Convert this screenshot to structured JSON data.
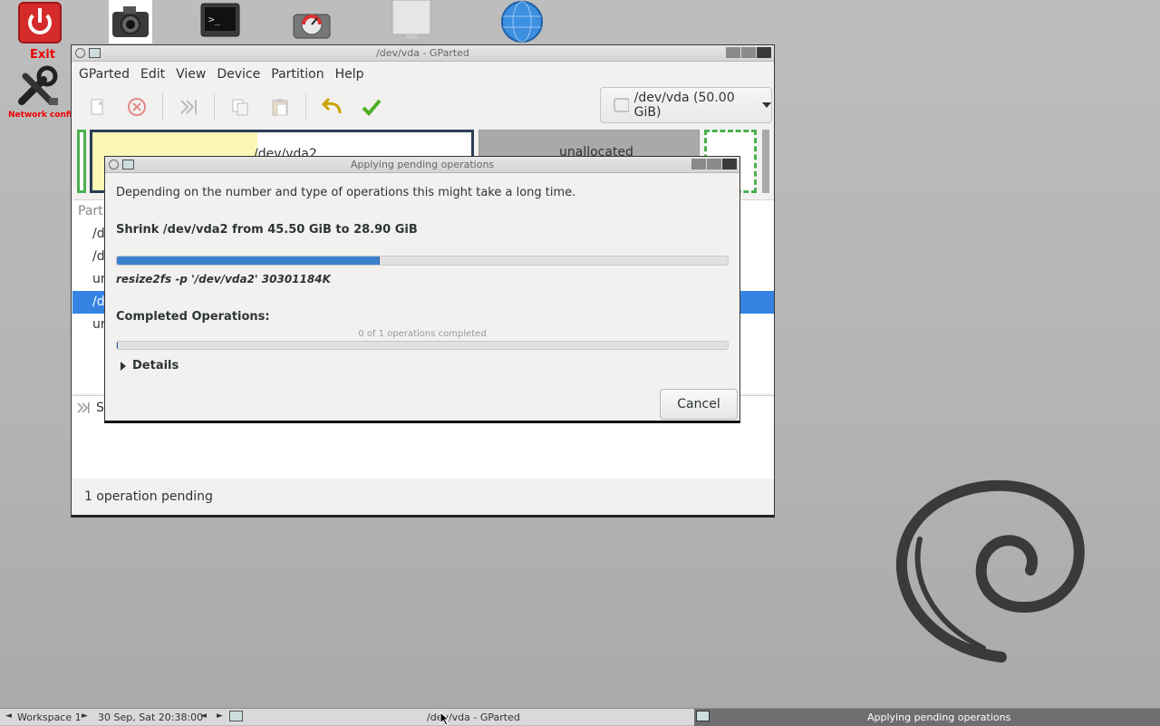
{
  "desktop": {
    "exit_label": "Exit",
    "network_label": "Network confi",
    "icons": [
      "exit-icon",
      "network-config-icon",
      "camera-icon",
      "terminal-icon",
      "disk-utility-icon",
      "monitor-icon",
      "globe-icon"
    ]
  },
  "window": {
    "title": "/dev/vda - GParted",
    "menu": [
      "GParted",
      "Edit",
      "View",
      "Device",
      "Partition",
      "Help"
    ],
    "device_selector": "/dev/vda (50.00 GiB)",
    "partition_map": {
      "partition_label": "/dev/vda2",
      "unallocated_label": "unallocated"
    },
    "list_header": "Part",
    "rows": [
      "/d",
      "/d",
      "ur",
      "/d",
      "ur"
    ],
    "selected_row": 3,
    "operation_text": "Sh",
    "status_text": "1 operation pending"
  },
  "dialog": {
    "title": "Applying pending operations",
    "intro": "Depending on the number and type of operations this might take a long time.",
    "operation": "Shrink /dev/vda2 from 45.50 GiB to 28.90 GiB",
    "current_progress": 0.43,
    "command": "resize2fs -p '/dev/vda2' 30301184K",
    "completed_heading": "Completed Operations:",
    "completed_text": "0 of 1 operations completed",
    "completed_progress": 0,
    "details_label": "Details",
    "cancel_label": "Cancel"
  },
  "taskbar": {
    "workspace": "Workspace 1",
    "clock": "30 Sep, Sat 20:38:00",
    "task1": "/dev/vda - GParted",
    "task2": "Applying pending operations"
  },
  "colors": {
    "accent": "#3584e4",
    "progress": "#3c7fcf",
    "exit_red": "#d52b2b"
  }
}
